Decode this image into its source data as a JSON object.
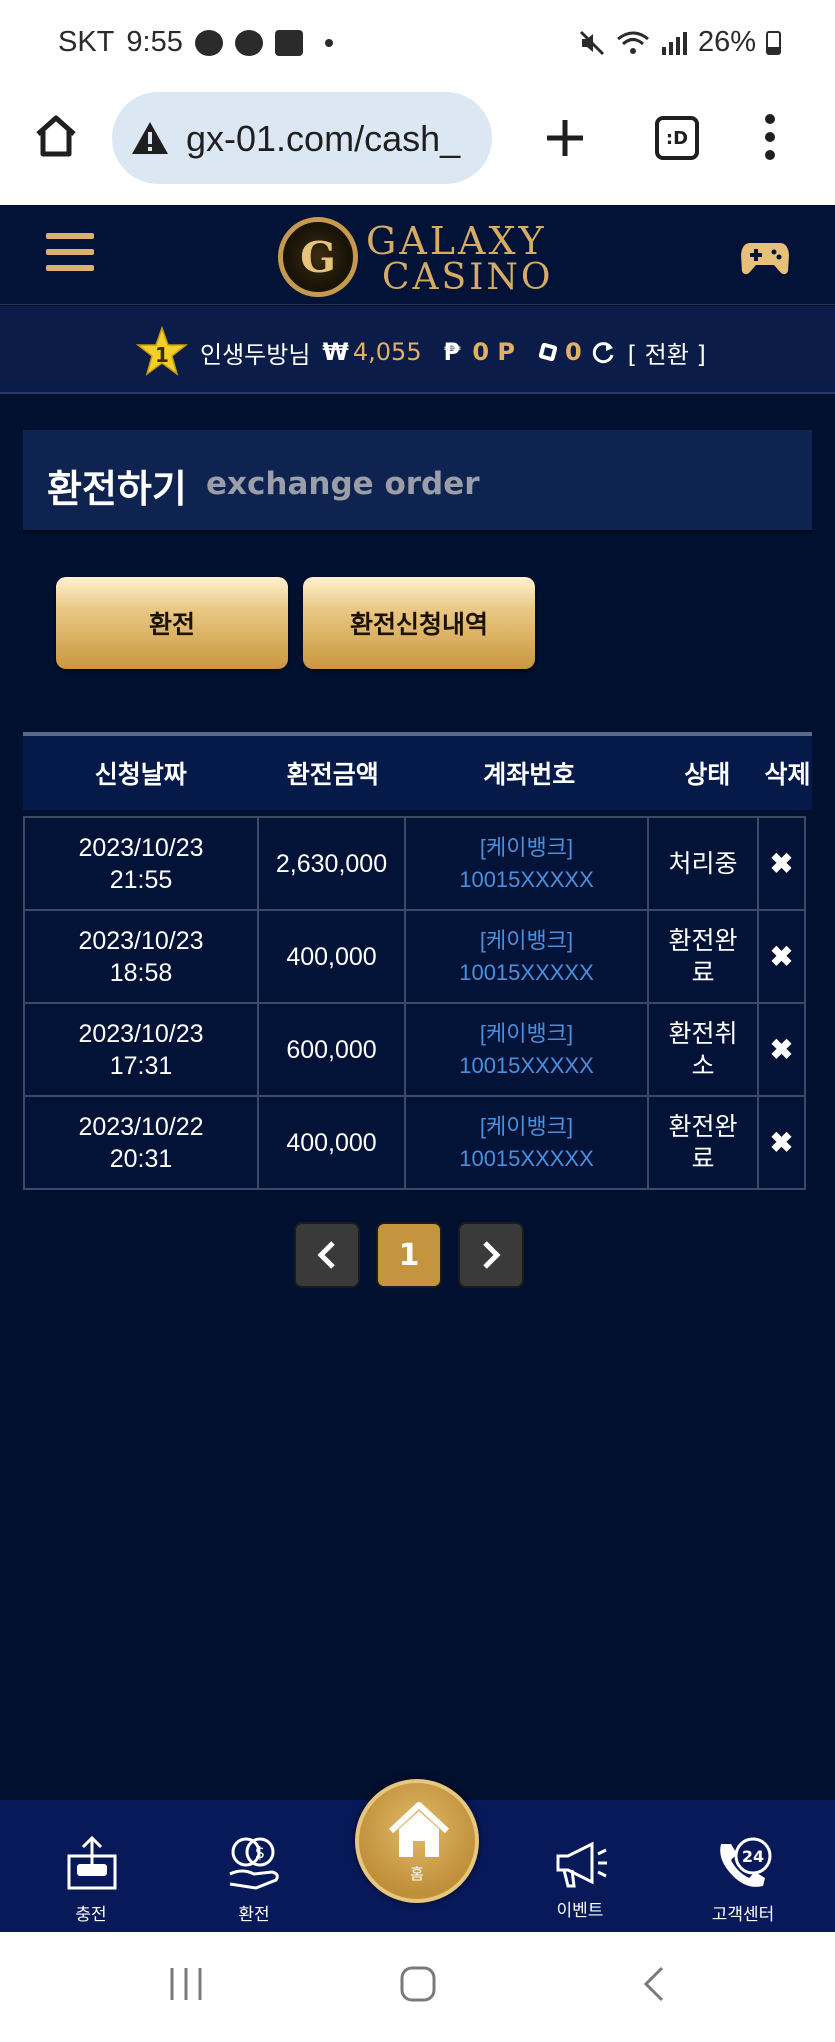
{
  "status_bar": {
    "carrier": "SKT",
    "time": "9:55",
    "battery": "26%"
  },
  "browser": {
    "url": "gx-01.com/cash_",
    "tabs_label": ":D"
  },
  "site": {
    "logo_letter": "G",
    "logo_line1": "GALAXY",
    "logo_line2": "CASINO"
  },
  "user": {
    "level": "1",
    "name": "인생두방님",
    "currency_symbol": "₩",
    "balance": "4,055",
    "point_symbol": "₱",
    "points": "0 P",
    "chips": "0",
    "switch_label": "[ 전환 ]"
  },
  "page": {
    "title_ko": "환전하기",
    "title_en": "exchange order"
  },
  "tabs": {
    "exchange_label": "환전",
    "history_label": "환전신청내역"
  },
  "table": {
    "headers": [
      "신청날짜",
      "환전금액",
      "계좌번호",
      "상태",
      "삭제"
    ],
    "rows": [
      {
        "date": "2023/10/23",
        "time": "21:55",
        "amount": "2,630,000",
        "bank": "[케이뱅크]",
        "account": "10015XXXXX",
        "status": "처리중",
        "delete": "✖"
      },
      {
        "date": "2023/10/23",
        "time": "18:58",
        "amount": "400,000",
        "bank": "[케이뱅크]",
        "account": "10015XXXXX",
        "status": "환전완료",
        "delete": "✖"
      },
      {
        "date": "2023/10/23",
        "time": "17:31",
        "amount": "600,000",
        "bank": "[케이뱅크]",
        "account": "10015XXXXX",
        "status": "환전취소",
        "delete": "✖"
      },
      {
        "date": "2023/10/22",
        "time": "20:31",
        "amount": "400,000",
        "bank": "[케이뱅크]",
        "account": "10015XXXXX",
        "status": "환전완료",
        "delete": "✖"
      }
    ]
  },
  "pagination": {
    "current": "1"
  },
  "bottom_nav": {
    "charge": "충전",
    "exchange": "환전",
    "home": "홈",
    "event": "이벤트",
    "support": "고객센터"
  },
  "colors": {
    "background": "#02102f",
    "gold": "#c9973f",
    "account_link": "#4a8fde"
  }
}
